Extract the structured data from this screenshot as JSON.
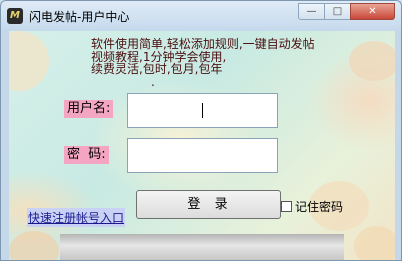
{
  "window": {
    "icon_name": "app-logo-icon",
    "icon_glyph": "M",
    "title": "闪电发帖-用户中心",
    "min_glyph": "—",
    "max_glyph": "□",
    "close_glyph": "✕"
  },
  "notice": {
    "lines": [
      "软件使用简单,轻松添加规则,一键自动发帖",
      "视频教程,1分钟学会使用,",
      "续费灵活,包时,包月,包年"
    ],
    "dot": "."
  },
  "form": {
    "username_label": "用户名:",
    "username_value": "",
    "password_label": "密  码:",
    "password_value": "",
    "register_link": "快速注册帐号入口",
    "login_button": "登  录",
    "remember_label": "记住密码",
    "remember_checked": false
  },
  "colors": {
    "label_bg": "#f4a5c2",
    "notice_text": "#4a0f0f",
    "link_text": "#1a1a8c"
  }
}
